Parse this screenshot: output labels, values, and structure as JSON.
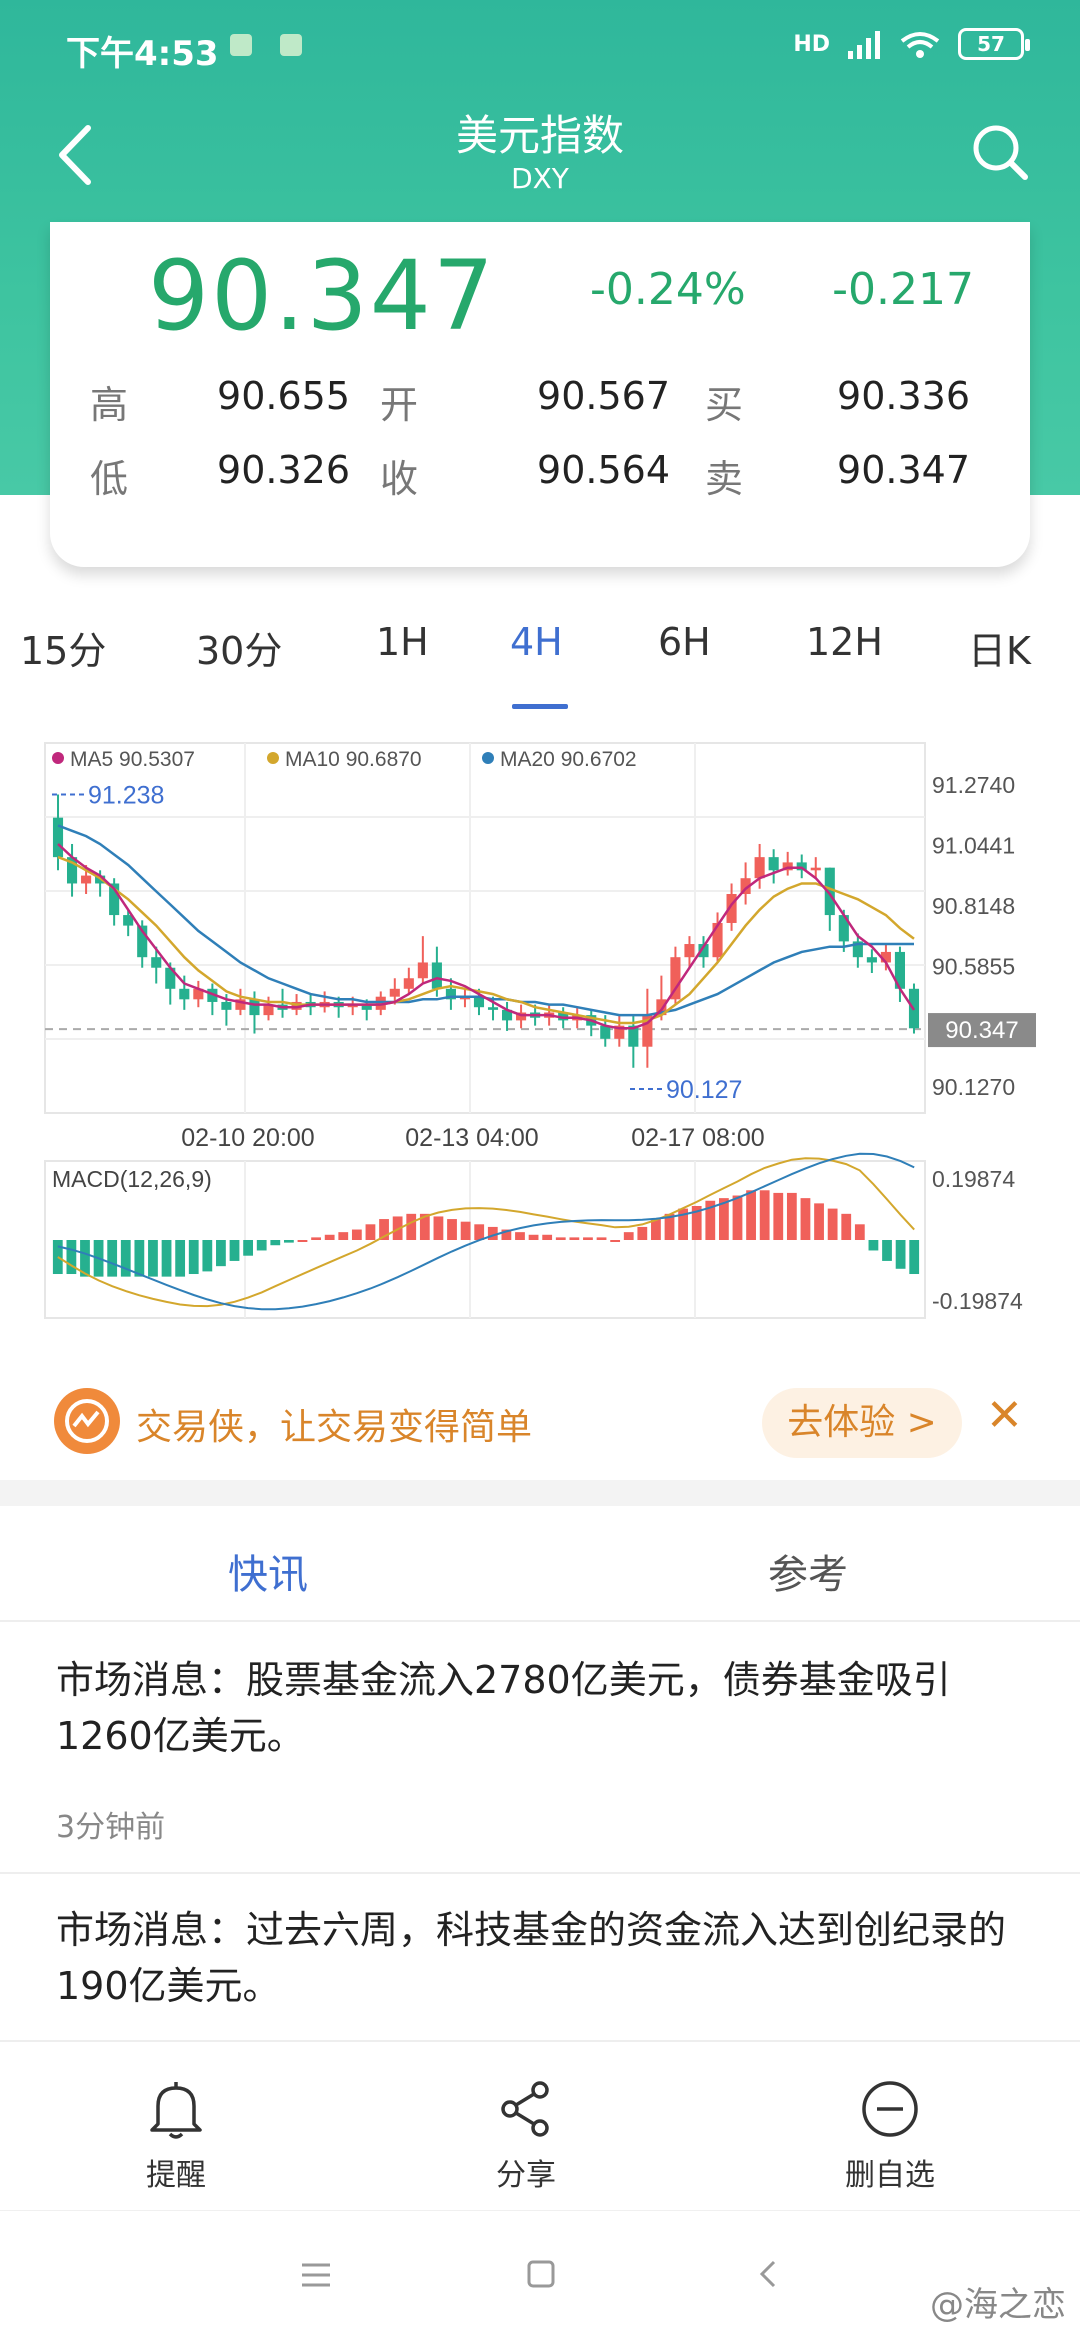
{
  "status": {
    "time": "下午4:53",
    "battery": "57",
    "network": "HD"
  },
  "header": {
    "title": "美元指数",
    "subtitle": "DXY"
  },
  "quote": {
    "price": "90.347",
    "change_pct": "-0.24%",
    "change": "-0.217",
    "rows": [
      [
        {
          "label": "高",
          "value": "90.655"
        },
        {
          "label": "开",
          "value": "90.567"
        },
        {
          "label": "买",
          "value": "90.336"
        }
      ],
      [
        {
          "label": "低",
          "value": "90.326"
        },
        {
          "label": "收",
          "value": "90.564"
        },
        {
          "label": "卖",
          "value": "90.347"
        }
      ]
    ],
    "color": "#26a86c"
  },
  "periods": [
    "15分",
    "30分",
    "1H",
    "4H",
    "6H",
    "12H",
    "日K"
  ],
  "active_period": "4H",
  "chart": {
    "legend": [
      {
        "label": "MA5 90.5307",
        "color": "#c0287c"
      },
      {
        "label": "MA10 90.6870",
        "color": "#d3a72d"
      },
      {
        "label": "MA20 90.6702",
        "color": "#2f7fb8"
      }
    ],
    "y_ticks": [
      "91.2740",
      "91.0441",
      "90.8148",
      "90.5855",
      "90.1270"
    ],
    "price_tag": "90.347",
    "high_mark": "91.238",
    "low_mark": "90.127",
    "x_ticks": [
      "02-10 20:00",
      "02-13 04:00",
      "02-17 08:00"
    ],
    "macd_label": "MACD(12,26,9)",
    "macd_ticks": [
      "0.19874",
      "-0.19874"
    ],
    "up_color": "#f0605a",
    "down_color": "#26b08f"
  },
  "chart_data": {
    "type": "candlestick",
    "ylim": [
      90.127,
      91.274
    ],
    "candles": [
      [
        91.15,
        91.0,
        91.238,
        90.95
      ],
      [
        91.0,
        90.9,
        91.05,
        90.85
      ],
      [
        90.9,
        90.93,
        90.97,
        90.86
      ],
      [
        90.93,
        90.9,
        90.95,
        90.85
      ],
      [
        90.9,
        90.78,
        90.92,
        90.74
      ],
      [
        90.78,
        90.74,
        90.8,
        90.7
      ],
      [
        90.74,
        90.62,
        90.76,
        90.58
      ],
      [
        90.62,
        90.58,
        90.66,
        90.52
      ],
      [
        90.58,
        90.5,
        90.6,
        90.44
      ],
      [
        90.5,
        90.46,
        90.55,
        90.42
      ],
      [
        90.46,
        90.5,
        90.53,
        90.43
      ],
      [
        90.5,
        90.45,
        90.52,
        90.4
      ],
      [
        90.45,
        90.42,
        90.48,
        90.36
      ],
      [
        90.42,
        90.46,
        90.5,
        90.4
      ],
      [
        90.46,
        90.4,
        90.49,
        90.33
      ],
      [
        90.4,
        90.44,
        90.47,
        90.38
      ],
      [
        90.44,
        90.42,
        90.5,
        90.39
      ],
      [
        90.42,
        90.45,
        90.48,
        90.4
      ],
      [
        90.45,
        90.43,
        90.48,
        90.4
      ],
      [
        90.43,
        90.45,
        90.49,
        90.41
      ],
      [
        90.45,
        90.43,
        90.47,
        90.39
      ],
      [
        90.43,
        90.44,
        90.47,
        90.4
      ],
      [
        90.44,
        90.42,
        90.46,
        90.38
      ],
      [
        90.42,
        90.47,
        90.49,
        90.4
      ],
      [
        90.47,
        90.5,
        90.54,
        90.44
      ],
      [
        90.5,
        90.54,
        90.58,
        90.48
      ],
      [
        90.54,
        90.6,
        90.7,
        90.52
      ],
      [
        90.6,
        90.5,
        90.66,
        90.47
      ],
      [
        90.5,
        90.46,
        90.54,
        90.42
      ],
      [
        90.46,
        90.47,
        90.5,
        90.43
      ],
      [
        90.47,
        90.43,
        90.5,
        90.4
      ],
      [
        90.43,
        90.42,
        90.47,
        90.38
      ],
      [
        90.42,
        90.38,
        90.45,
        90.34
      ],
      [
        90.38,
        90.41,
        90.44,
        90.35
      ],
      [
        90.41,
        90.39,
        90.44,
        90.36
      ],
      [
        90.39,
        90.41,
        90.44,
        90.36
      ],
      [
        90.41,
        90.38,
        90.43,
        90.35
      ],
      [
        90.38,
        90.4,
        90.43,
        90.35
      ],
      [
        90.4,
        90.36,
        90.42,
        90.32
      ],
      [
        90.36,
        90.31,
        90.4,
        90.28
      ],
      [
        90.31,
        90.36,
        90.4,
        90.28
      ],
      [
        90.36,
        90.28,
        90.4,
        90.2
      ],
      [
        90.28,
        90.4,
        90.5,
        90.2
      ],
      [
        90.4,
        90.46,
        90.55,
        90.38
      ],
      [
        90.46,
        90.62,
        90.66,
        90.44
      ],
      [
        90.62,
        90.67,
        90.7,
        90.58
      ],
      [
        90.67,
        90.62,
        90.7,
        90.58
      ],
      [
        90.62,
        90.75,
        90.79,
        90.6
      ],
      [
        90.75,
        90.86,
        90.9,
        90.72
      ],
      [
        90.86,
        90.92,
        90.98,
        90.82
      ],
      [
        90.92,
        91.0,
        91.05,
        90.88
      ],
      [
        91.0,
        90.95,
        91.03,
        90.9
      ],
      [
        90.95,
        90.98,
        91.02,
        90.93
      ],
      [
        90.98,
        90.95,
        91.01,
        90.92
      ],
      [
        90.95,
        90.96,
        91.0,
        90.92
      ],
      [
        90.96,
        90.78,
        90.96,
        90.72
      ],
      [
        90.78,
        90.68,
        90.8,
        90.64
      ],
      [
        90.68,
        90.62,
        90.71,
        90.58
      ],
      [
        90.62,
        90.6,
        90.65,
        90.56
      ],
      [
        90.6,
        90.64,
        90.67,
        90.57
      ],
      [
        90.64,
        90.5,
        90.66,
        90.45
      ],
      [
        90.5,
        90.35,
        90.52,
        90.33
      ]
    ],
    "ma5": [
      91.05,
      91.0,
      90.96,
      90.93,
      90.88,
      90.8,
      90.72,
      90.65,
      90.58,
      90.52,
      90.5,
      90.48,
      90.46,
      90.45,
      90.44,
      90.44,
      90.43,
      90.43,
      90.44,
      90.44,
      90.44,
      90.44,
      90.44,
      90.44,
      90.45,
      90.48,
      90.52,
      90.54,
      90.53,
      90.51,
      90.48,
      90.45,
      90.42,
      90.4,
      90.4,
      90.4,
      90.39,
      90.39,
      90.38,
      90.36,
      90.35,
      90.35,
      90.37,
      90.42,
      90.5,
      90.58,
      90.66,
      90.74,
      90.82,
      90.88,
      90.92,
      90.94,
      90.96,
      90.96,
      90.92,
      90.86,
      90.78,
      90.7,
      90.66,
      90.6,
      90.5,
      90.42
    ],
    "ma10": [
      91.0,
      90.98,
      90.95,
      90.92,
      90.88,
      90.84,
      90.79,
      90.74,
      90.68,
      90.62,
      90.57,
      90.53,
      90.49,
      90.47,
      90.46,
      90.45,
      90.45,
      90.44,
      90.44,
      90.44,
      90.44,
      90.44,
      90.44,
      90.44,
      90.45,
      90.46,
      90.48,
      90.5,
      90.51,
      90.5,
      90.49,
      90.48,
      90.46,
      90.45,
      90.43,
      90.42,
      90.41,
      90.4,
      90.39,
      90.38,
      90.37,
      90.37,
      90.38,
      90.4,
      90.44,
      90.48,
      90.54,
      90.6,
      90.67,
      90.74,
      90.8,
      90.85,
      90.88,
      90.9,
      90.9,
      90.88,
      90.86,
      90.84,
      90.81,
      90.78,
      90.73,
      90.69
    ],
    "ma20": [
      91.12,
      91.1,
      91.08,
      91.05,
      91.01,
      90.97,
      90.92,
      90.87,
      90.82,
      90.77,
      90.72,
      90.68,
      90.64,
      90.6,
      90.57,
      90.54,
      90.52,
      90.5,
      90.48,
      90.47,
      90.46,
      90.46,
      90.45,
      90.45,
      90.45,
      90.45,
      90.46,
      90.46,
      90.47,
      90.47,
      90.47,
      90.46,
      90.46,
      90.45,
      90.45,
      90.44,
      90.44,
      90.43,
      90.42,
      90.41,
      90.4,
      90.4,
      90.4,
      90.41,
      90.42,
      90.44,
      90.46,
      90.48,
      90.51,
      90.54,
      90.57,
      90.6,
      90.62,
      90.64,
      90.65,
      90.66,
      90.66,
      90.67,
      90.67,
      90.67,
      90.67,
      90.67
    ],
    "macd_hist": [
      -0.13,
      -0.13,
      -0.14,
      -0.14,
      -0.14,
      -0.14,
      -0.14,
      -0.14,
      -0.14,
      -0.14,
      -0.13,
      -0.12,
      -0.1,
      -0.08,
      -0.06,
      -0.04,
      -0.02,
      -0.01,
      0.0,
      0.01,
      0.02,
      0.03,
      0.04,
      0.06,
      0.08,
      0.09,
      0.1,
      0.1,
      0.09,
      0.08,
      0.07,
      0.06,
      0.05,
      0.04,
      0.03,
      0.02,
      0.02,
      0.01,
      0.01,
      0.01,
      0.01,
      0.0,
      0.03,
      0.05,
      0.08,
      0.1,
      0.12,
      0.13,
      0.15,
      0.16,
      0.17,
      0.19,
      0.19,
      0.18,
      0.18,
      0.16,
      0.14,
      0.12,
      0.1,
      0.06,
      -0.04,
      -0.08,
      -0.11,
      -0.13
    ],
    "macd_ylim": [
      -0.19874,
      0.19874
    ]
  },
  "promo": {
    "text": "交易侠，让交易变得简单",
    "button": "去体验 >",
    "close": "✕"
  },
  "news_tabs": [
    "快讯",
    "参考"
  ],
  "news": [
    {
      "title": "市场消息：股票基金流入2780亿美元，债券基金吸引1260亿美元。",
      "time": "3分钟前"
    },
    {
      "title": "市场消息：过去六周，科技基金的资金流入达到创纪录的190亿美元。",
      "time": ""
    }
  ],
  "toolbar": [
    {
      "label": "提醒",
      "icon": "bell-icon"
    },
    {
      "label": "分享",
      "icon": "share-icon"
    },
    {
      "label": "删自选",
      "icon": "remove-watchlist-icon"
    }
  ],
  "watermark": "@海之恋"
}
